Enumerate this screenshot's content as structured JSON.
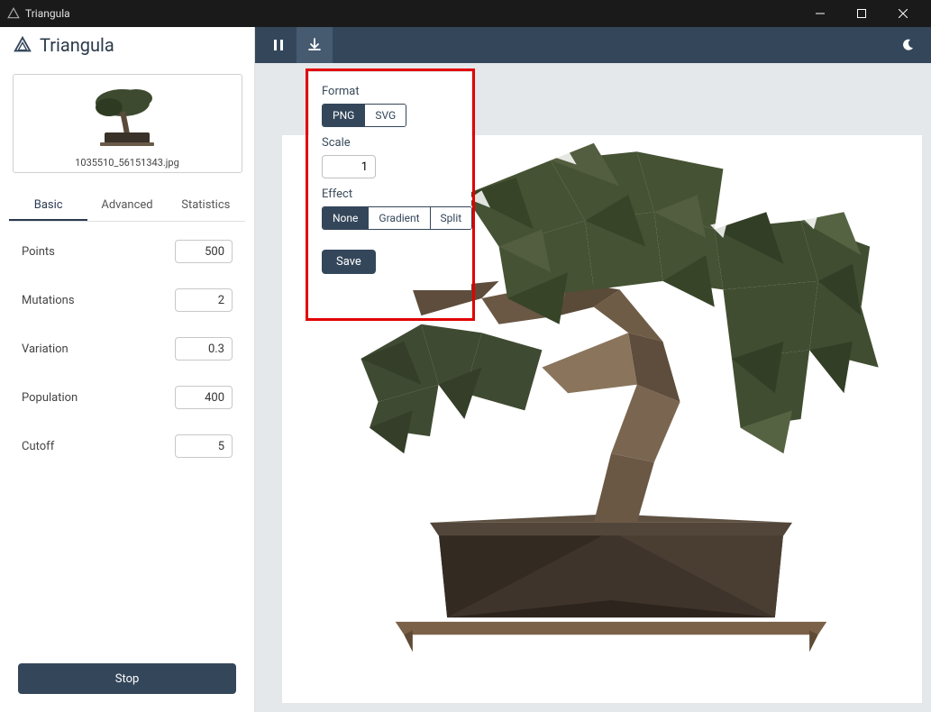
{
  "window": {
    "title": "Triangula"
  },
  "app": {
    "name": "Triangula"
  },
  "thumbnail": {
    "filename": "1035510_56151343.jpg"
  },
  "tabs": {
    "basic": "Basic",
    "advanced": "Advanced",
    "statistics": "Statistics"
  },
  "params": {
    "points": {
      "label": "Points",
      "value": "500"
    },
    "mutations": {
      "label": "Mutations",
      "value": "2"
    },
    "variation": {
      "label": "Variation",
      "value": "0.3"
    },
    "population": {
      "label": "Population",
      "value": "400"
    },
    "cutoff": {
      "label": "Cutoff",
      "value": "5"
    }
  },
  "actions": {
    "stop": "Stop"
  },
  "export": {
    "format_label": "Format",
    "format_png": "PNG",
    "format_svg": "SVG",
    "scale_label": "Scale",
    "scale_value": "1",
    "effect_label": "Effect",
    "effect_none": "None",
    "effect_gradient": "Gradient",
    "effect_split": "Split",
    "save": "Save"
  },
  "colors": {
    "primary": "#34465a",
    "highlight": "#e20000"
  }
}
